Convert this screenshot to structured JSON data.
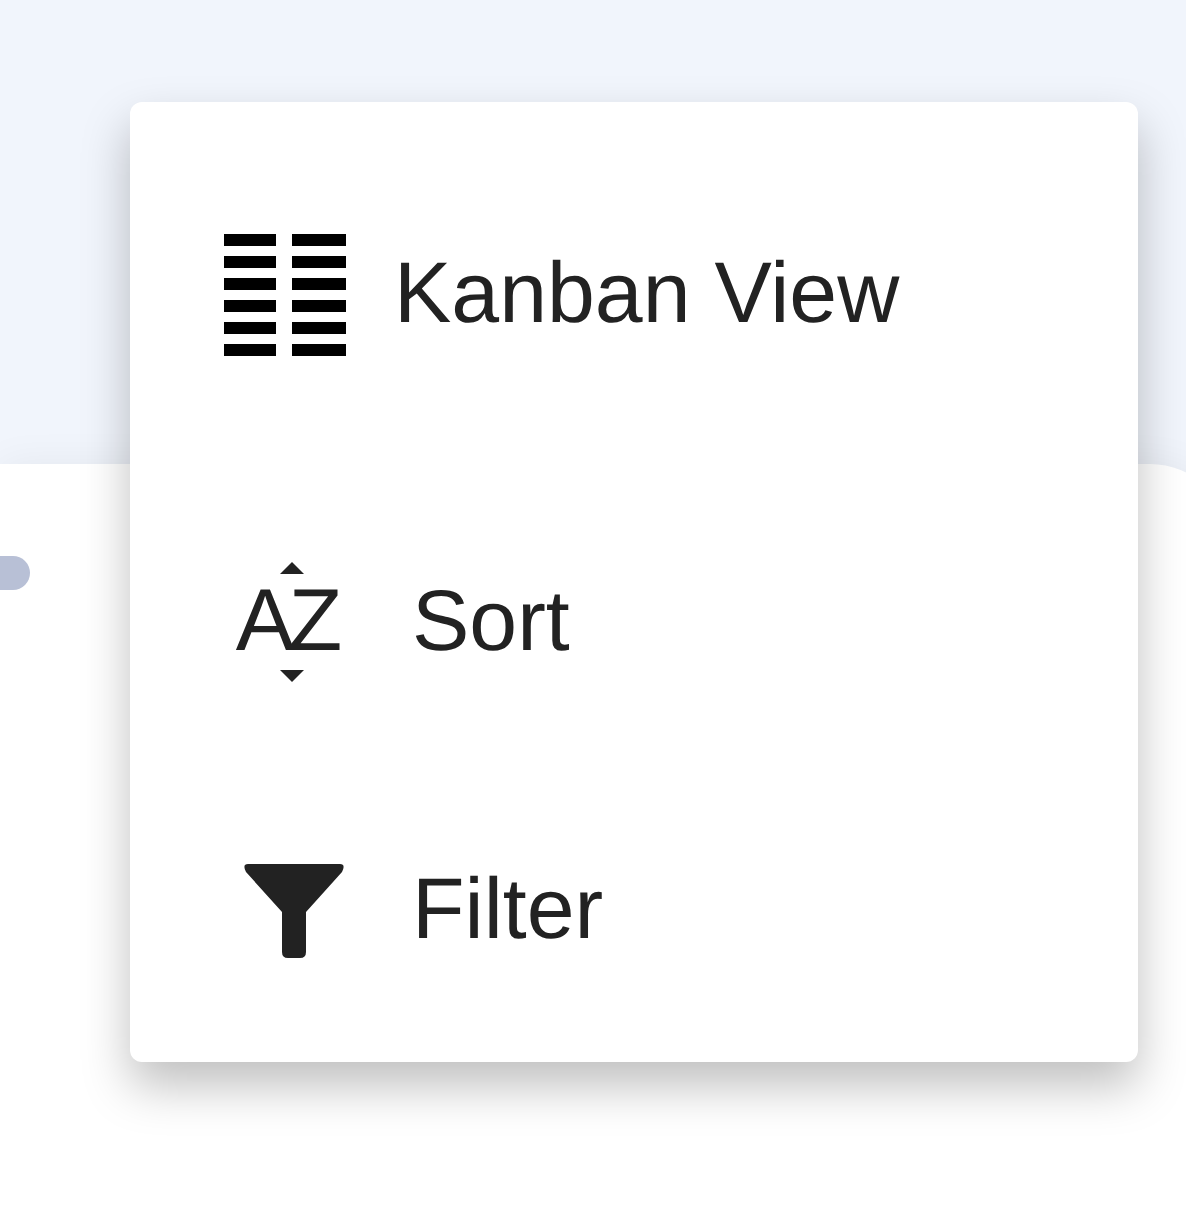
{
  "menu": {
    "items": [
      {
        "kind": "kanban",
        "label": "Kanban View"
      },
      {
        "kind": "sort",
        "label": "Sort",
        "icon_text": "AZ"
      },
      {
        "kind": "filter",
        "label": "Filter"
      }
    ]
  }
}
